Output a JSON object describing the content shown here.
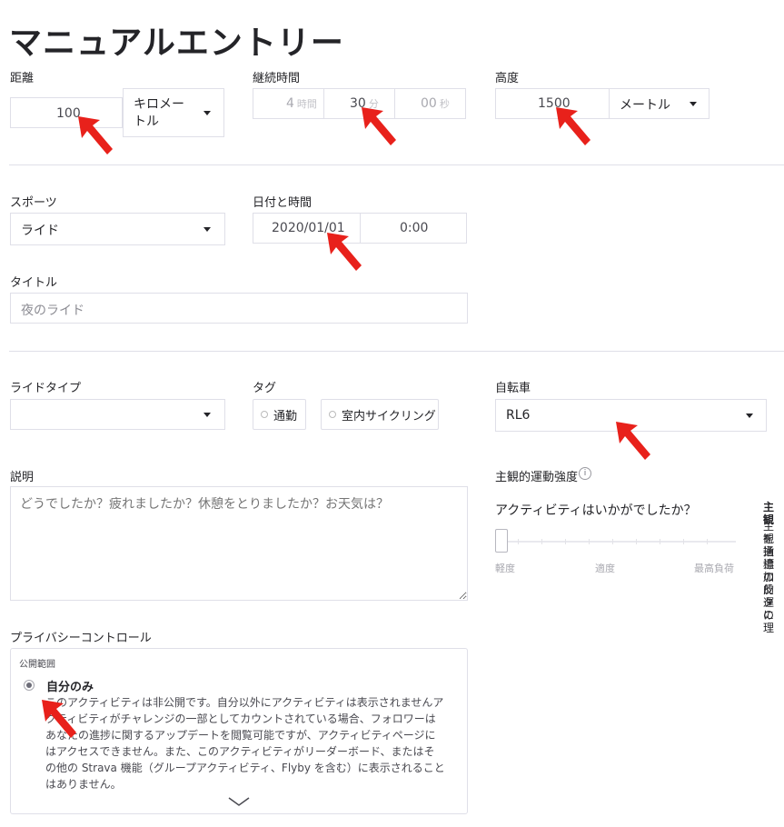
{
  "page_title": "マニュアルエントリー",
  "distance": {
    "label": "距離",
    "value": "100",
    "unit_select_line1": "キロメー",
    "unit_select_line2": "トル"
  },
  "duration": {
    "label": "継続時間",
    "hours": "4",
    "hours_unit": "時間",
    "minutes": "30",
    "minutes_unit": "分",
    "seconds": "00",
    "seconds_unit": "秒"
  },
  "elevation": {
    "label": "高度",
    "value": "1500",
    "unit_select": "メートル"
  },
  "sport": {
    "label": "スポーツ",
    "value": "ライド"
  },
  "datetime": {
    "label": "日付と時間",
    "date": "2020/01/01",
    "time": "0:00"
  },
  "title_field": {
    "label": "タイトル",
    "value": "夜のライド"
  },
  "ride_type": {
    "label": "ライドタイプ",
    "value": ""
  },
  "tags": {
    "label": "タグ",
    "items": [
      "通勤",
      "室内サイクリング"
    ]
  },
  "bike": {
    "label": "自転車",
    "value": "RL6"
  },
  "description": {
    "label": "説明",
    "placeholder": "どうでしたか？疲れましたか？休憩をとりましたか？お天気は？"
  },
  "perceived_exertion": {
    "label": "主観的運動強度",
    "info_icon": "i",
    "question": "アクティビティはいかがでしたか？",
    "level": 0,
    "scale": [
      "軽度",
      "適度",
      "最高負荷"
    ],
    "side_title": "主観",
    "side_lines": [
      "主観",
      "を通",
      "指標",
      "追加",
      "の反",
      "的運",
      "タに",
      "の理"
    ]
  },
  "privacy": {
    "label": "プライバシーコントロール",
    "visibility_label": "公開範囲",
    "option_title": "自分のみ",
    "option_desc": "このアクティビティは非公開です。自分以外にアクティビティは表示されませんアクティビティがチャレンジの一部としてカウントされている場合、フォロワーはあなたの進捗に関するアップデートを閲覧可能ですが、アクティビティページにはアクセスできません。また、このアクティビティがリーダーボード、またはその他の Strava 機能（グループアクティビティ、Flyby を含む）に表示されることはありません。"
  },
  "colors": {
    "arrow": "#e8211b",
    "text": "#242428",
    "border": "#dfdfe8"
  }
}
